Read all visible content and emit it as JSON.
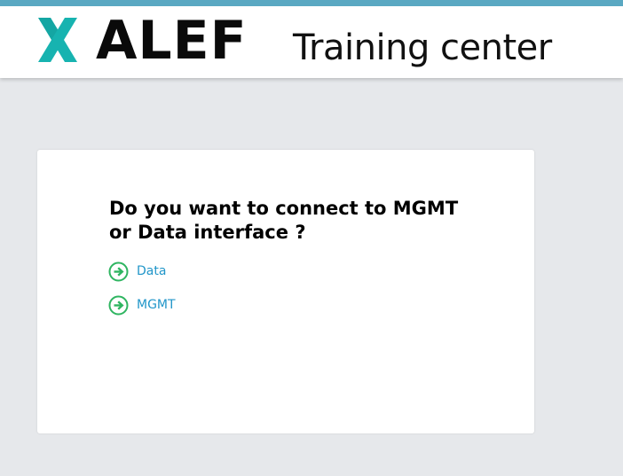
{
  "header": {
    "brand_name": "ALEF",
    "app_title": "Training center"
  },
  "prompt": {
    "question": "Do you want to connect to MGMT or Data interface ?"
  },
  "options": [
    {
      "label": "Data",
      "icon": "arrow-circle-right-icon"
    },
    {
      "label": "MGMT",
      "icon": "arrow-circle-right-icon"
    }
  ],
  "colors": {
    "accent_bar": "#5aa8c2",
    "logo_teal": "#17b3b0",
    "link_blue": "#2196c9",
    "icon_green": "#2fb561",
    "page_background": "#e6e8eb"
  }
}
